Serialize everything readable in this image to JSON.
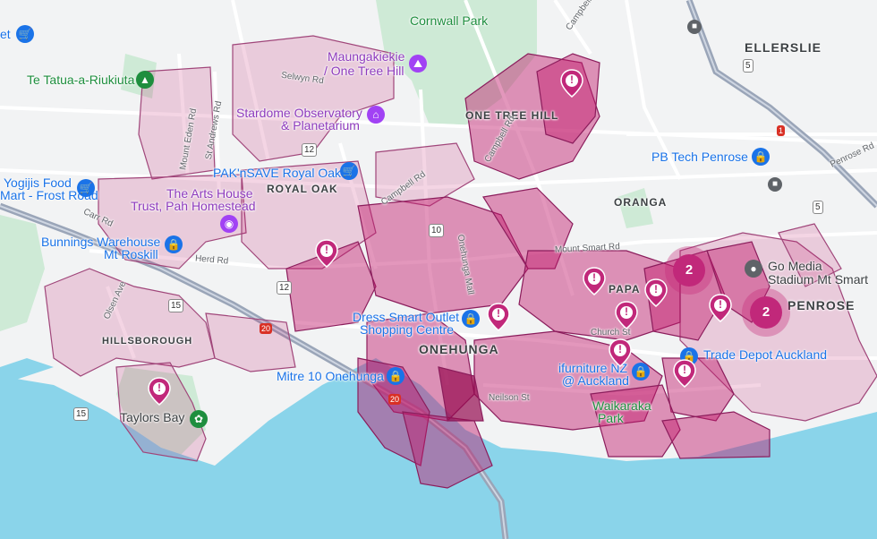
{
  "map": {
    "colors": {
      "land": "#f2f3f4",
      "water": "#8ad4ea",
      "park": "#ceead6",
      "road": "#ffffff",
      "highway": "#9aa5b8",
      "zone_fill": "#c2186b",
      "zone_stroke": "#8b1d5c",
      "marker": "#c1287a"
    },
    "labels": {
      "cornwall_park": "Cornwall Park",
      "maungakiekie": "Maungakiekie",
      "one_tree_hill_poi": "/ One Tree Hill",
      "te_tatua": "Te Tatua-a-Riukiuta",
      "stardome_1": "Stardome Observatory",
      "stardome_2": "& Planetarium",
      "paknsave": "PAK'nSAVE Royal Oak",
      "yogijis_1": "Yogijis Food",
      "yogijis_2": "Mart - Frost Road",
      "arts_house_1": "The Arts House",
      "arts_house_2": "Trust, Pah Homestead",
      "bunnings_1": "Bunnings Warehouse",
      "bunnings_2": "Mt Roskill",
      "mitre10": "Mitre 10 Onehunga",
      "dress_smart_1": "Dress Smart Outlet",
      "dress_smart_2": "Shopping Centre",
      "ifurniture_1": "ifurniture NZ",
      "ifurniture_2": "@ Auckland",
      "trade_depot": "Trade Depot Auckland",
      "go_media_1": "Go Media",
      "go_media_2": "Stadium Mt Smart",
      "pb_tech": "PB Tech Penrose",
      "taylors_bay": "Taylors Bay",
      "waikaraka_1": "Waikaraka",
      "waikaraka_2": "Park",
      "top_left_partial": "et"
    },
    "suburbs": {
      "ellerslie": "ELLERSLIE",
      "one_tree_hill": "ONE TREE HILL",
      "royal_oak": "ROYAL OAK",
      "oranga": "ORANGA",
      "onehunga": "ONEHUNGA",
      "penrose": "PENROSE",
      "hillsborough": "HILLSBOROUGH",
      "papa": "PAPA"
    },
    "roads": {
      "selwyn": "Selwyn Rd",
      "mount_eden": "Mount Eden Rd",
      "st_andrews": "St Andrews Rd",
      "campbell_1": "Campbell Rd",
      "campbell_2": "Campbell Rd",
      "campbell_3": "Campbell",
      "carr": "Carr Rd",
      "herd": "Herd Rd",
      "olsen": "Olsen Ave",
      "mount_smart": "Mount Smart Rd",
      "church": "Church St",
      "neilson": "Neilson St",
      "onehunga_mall": "Onehunga Mall",
      "penrose_rd": "Penrose Rd"
    },
    "highway_shields": {
      "h5a": "5",
      "h5b": "5",
      "h1": "1",
      "h12a": "12",
      "h12b": "12",
      "h15a": "15",
      "h15b": "15",
      "h20": "20",
      "h20b": "20",
      "h10": "10"
    },
    "clusters": [
      {
        "count": "2"
      },
      {
        "count": "2"
      }
    ],
    "alert_markers": [
      {
        "label": "!"
      },
      {
        "label": "!"
      },
      {
        "label": "!"
      },
      {
        "label": "!"
      },
      {
        "label": "!"
      },
      {
        "label": "!"
      },
      {
        "label": "!"
      },
      {
        "label": "!"
      },
      {
        "label": "!"
      },
      {
        "label": "!"
      },
      {
        "label": "!"
      }
    ]
  }
}
